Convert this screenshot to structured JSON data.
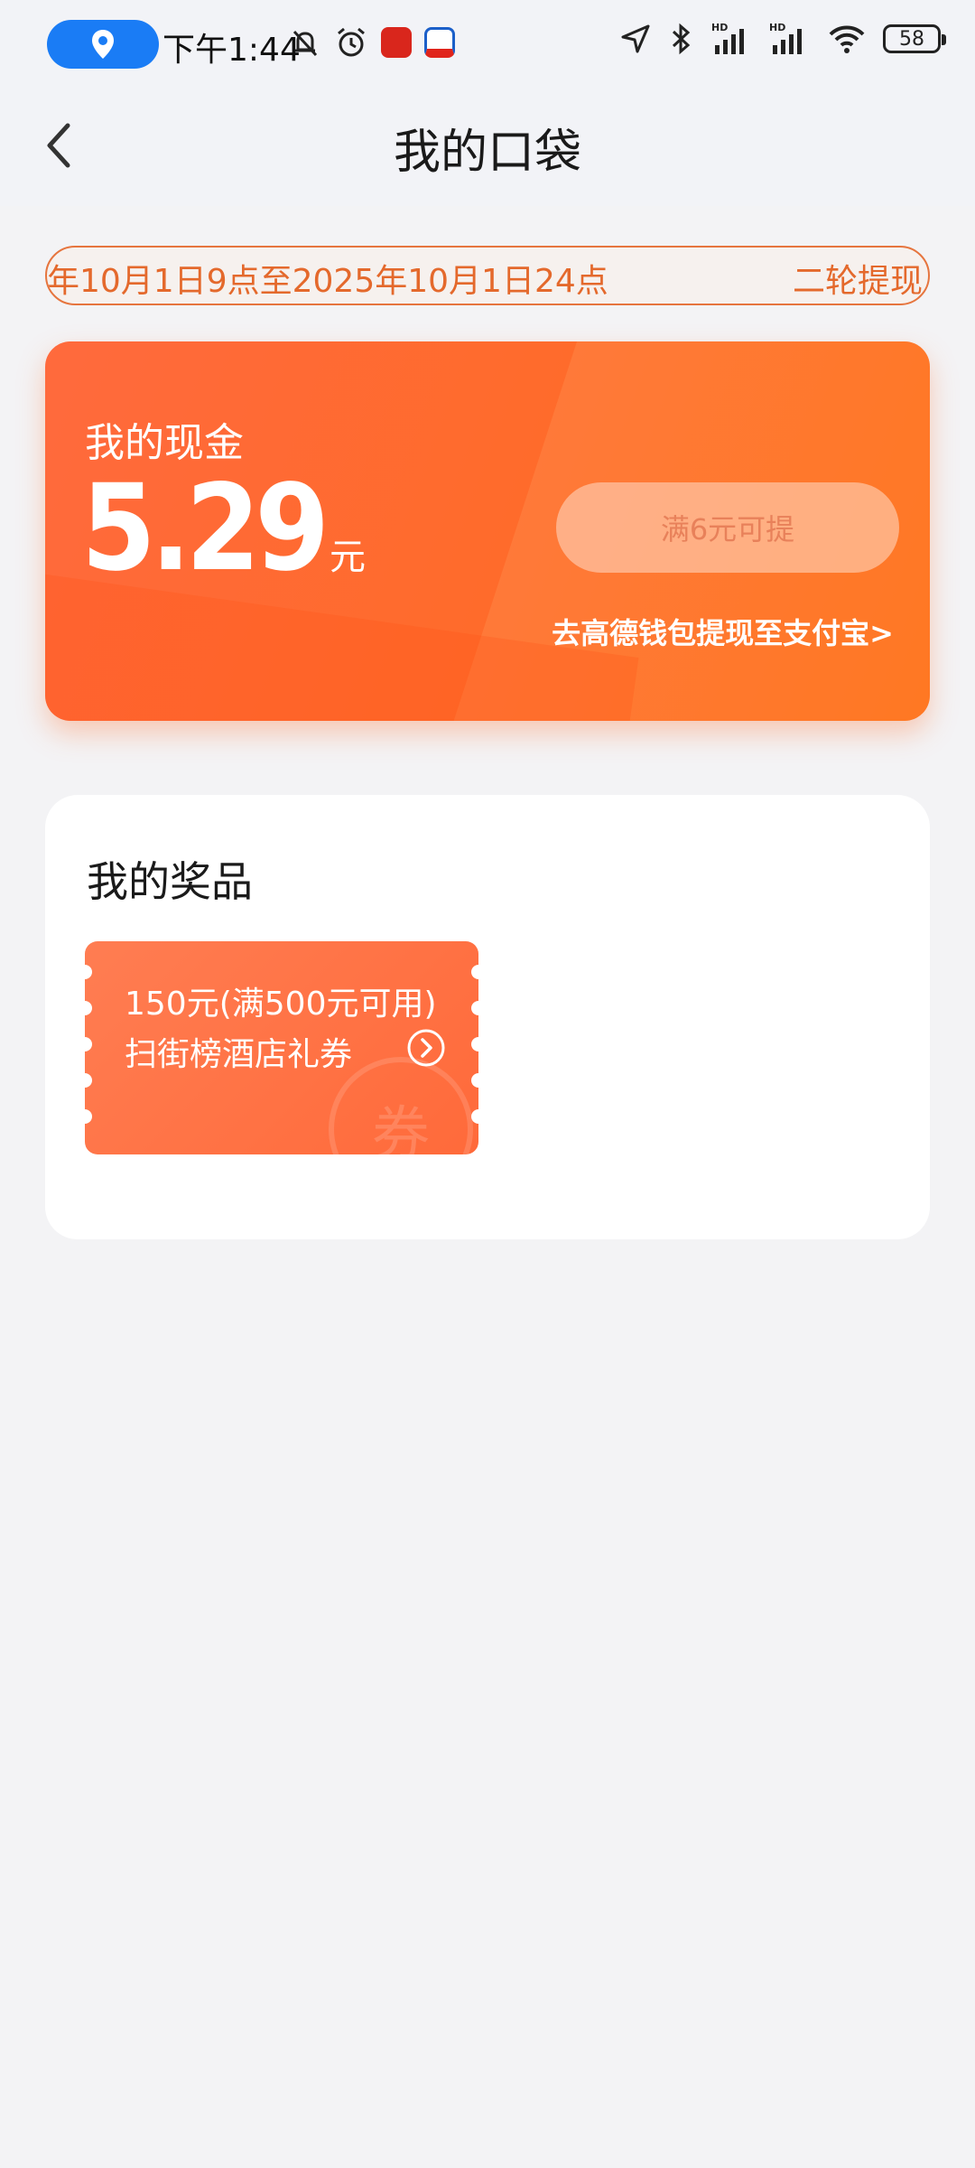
{
  "status_bar": {
    "time": "下午1:44",
    "battery": "58",
    "icons": [
      "location-pin-icon",
      "mute-bell-icon",
      "alarm-icon",
      "app-badge-icon",
      "app-badge-icon",
      "navigation-icon",
      "bluetooth-icon",
      "signal-hd-icon",
      "signal-hd-icon",
      "wifi-icon"
    ]
  },
  "header": {
    "title": "我的口袋"
  },
  "marquee": {
    "text": "年10月1日9点至2025年10月1日24点",
    "right_text": "二轮提现"
  },
  "cash": {
    "label": "我的现金",
    "amount": "5.29",
    "unit": "元",
    "withdraw_button": "满6元可提",
    "alipay_link": "去高德钱包提现至支付宝>"
  },
  "prizes": {
    "title": "我的奖品",
    "coupons": [
      {
        "line1": "150元(满500元可用)",
        "line2": "扫街榜酒店礼券",
        "watermark": "券"
      }
    ]
  },
  "colors": {
    "accent": "#ff6a2a",
    "accent_text": "#e4692c",
    "blue": "#1a7cf5",
    "background": "#f3f3f5"
  }
}
